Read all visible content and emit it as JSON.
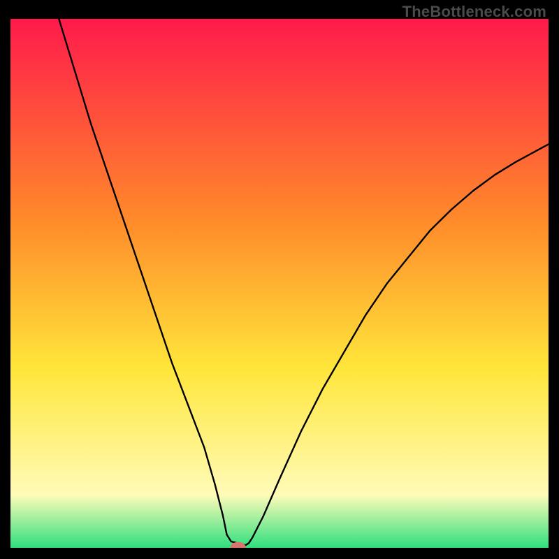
{
  "watermark": "TheBottleneck.com",
  "chart_data": {
    "type": "line",
    "title": "",
    "xlabel": "",
    "ylabel": "",
    "xlim": [
      0,
      100
    ],
    "ylim": [
      0,
      100
    ],
    "grid": false,
    "background_gradient": {
      "top": "#ff1a4b",
      "mid1": "#ff8a2a",
      "mid2": "#ffe63a",
      "mid3": "#fffbb8",
      "bottom": "#2fe07e"
    },
    "series": [
      {
        "name": "bottleneck-curve",
        "color": "#000000",
        "x": [
          9,
          12,
          15,
          18,
          21,
          24,
          27,
          30,
          33,
          36,
          38,
          39.5,
          40.2,
          41,
          43.7,
          44.3,
          45,
          47,
          50,
          54,
          58,
          62,
          66,
          70,
          74,
          78,
          82,
          86,
          90,
          94,
          98,
          100
        ],
        "values": [
          100,
          90,
          80,
          71,
          62,
          53,
          44,
          35,
          27,
          19,
          12,
          6,
          2.5,
          1.2,
          0.5,
          0.9,
          2,
          6,
          13,
          22,
          30,
          37,
          44,
          50,
          55,
          60,
          64,
          67.5,
          70.5,
          73,
          75.2,
          76.3
        ]
      }
    ],
    "marker": {
      "name": "minimum-marker",
      "x": 42.3,
      "y": 0.2,
      "rx": 1.4,
      "ry": 0.9,
      "color": "#d9746f"
    }
  }
}
